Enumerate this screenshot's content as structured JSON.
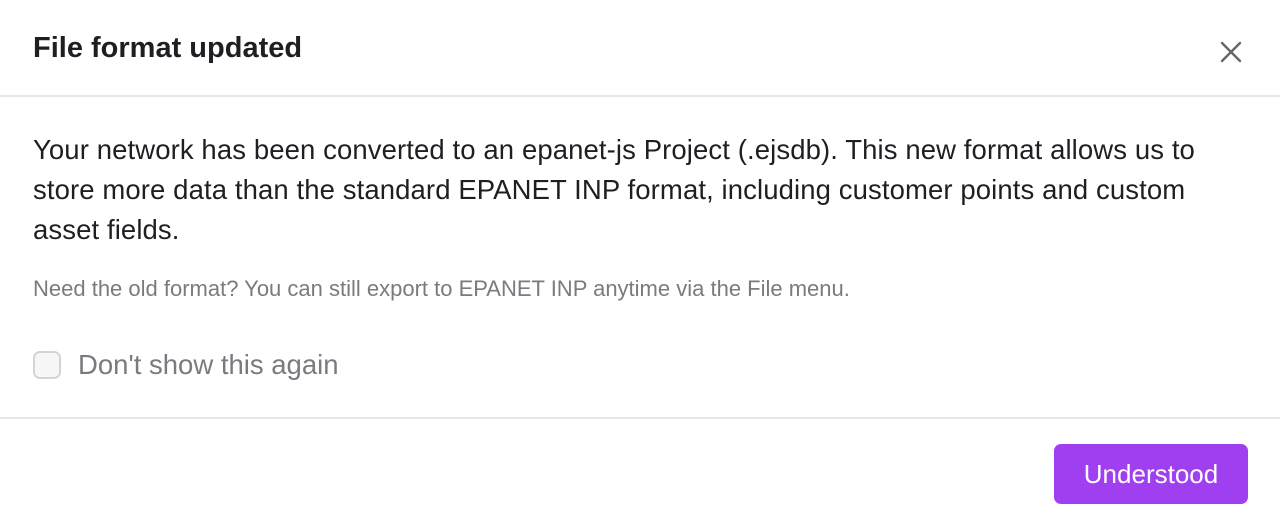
{
  "dialog": {
    "title": "File format updated",
    "close_icon": "close-icon",
    "message": "Your network has been converted to an epanet-js Project (.ejsdb). This new format allows us to store more data than the standard EPANET INP format, including customer points and custom asset fields.",
    "note": "Need the old format? You can still export to EPANET INP anytime via the File menu.",
    "checkbox": {
      "label": "Don't show this again",
      "checked": false
    },
    "primary_button_label": "Understood"
  },
  "colors": {
    "accent": "#a03ff0",
    "text_primary": "#1f1f23",
    "text_secondary": "#7a7a80",
    "divider": "#e6e6e8"
  }
}
